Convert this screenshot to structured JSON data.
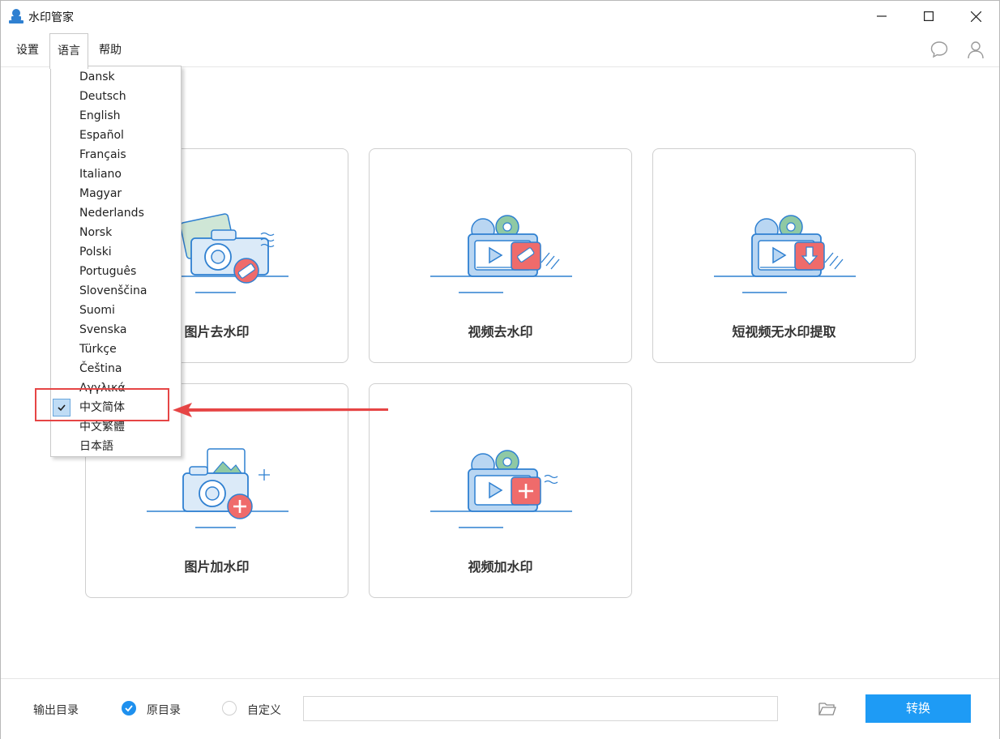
{
  "window": {
    "title": "水印管家"
  },
  "menu": {
    "settings": "设置",
    "language": "语言",
    "help": "帮助"
  },
  "language_menu": {
    "items": [
      "Dansk",
      "Deutsch",
      "English",
      "Español",
      "Français",
      "Italiano",
      "Magyar",
      "Nederlands",
      "Norsk",
      "Polski",
      "Português",
      "Slovenščina",
      "Suomi",
      "Svenska",
      "Türkçe",
      "Čeština",
      "Αγγλικά",
      "中文简体",
      "中文繁體",
      "日本語"
    ],
    "selected": "中文简体"
  },
  "cards": [
    {
      "label": "图片去水印",
      "icon": "photo-remove-watermark-icon"
    },
    {
      "label": "视频去水印",
      "icon": "video-remove-watermark-icon"
    },
    {
      "label": "短视频无水印提取",
      "icon": "short-video-extract-icon"
    },
    {
      "label": "图片加水印",
      "icon": "photo-add-watermark-icon"
    },
    {
      "label": "视频加水印",
      "icon": "video-add-watermark-icon"
    }
  ],
  "bottom": {
    "output_label": "输出目录",
    "option_original": "原目录",
    "option_custom": "自定义",
    "path_value": "",
    "convert": "转换"
  },
  "colors": {
    "accent": "#1e9bf5",
    "highlight": "#e64545",
    "icon_blue": "#2f80d1",
    "icon_red": "#ef6b6b",
    "icon_green": "#8fc9a4"
  }
}
